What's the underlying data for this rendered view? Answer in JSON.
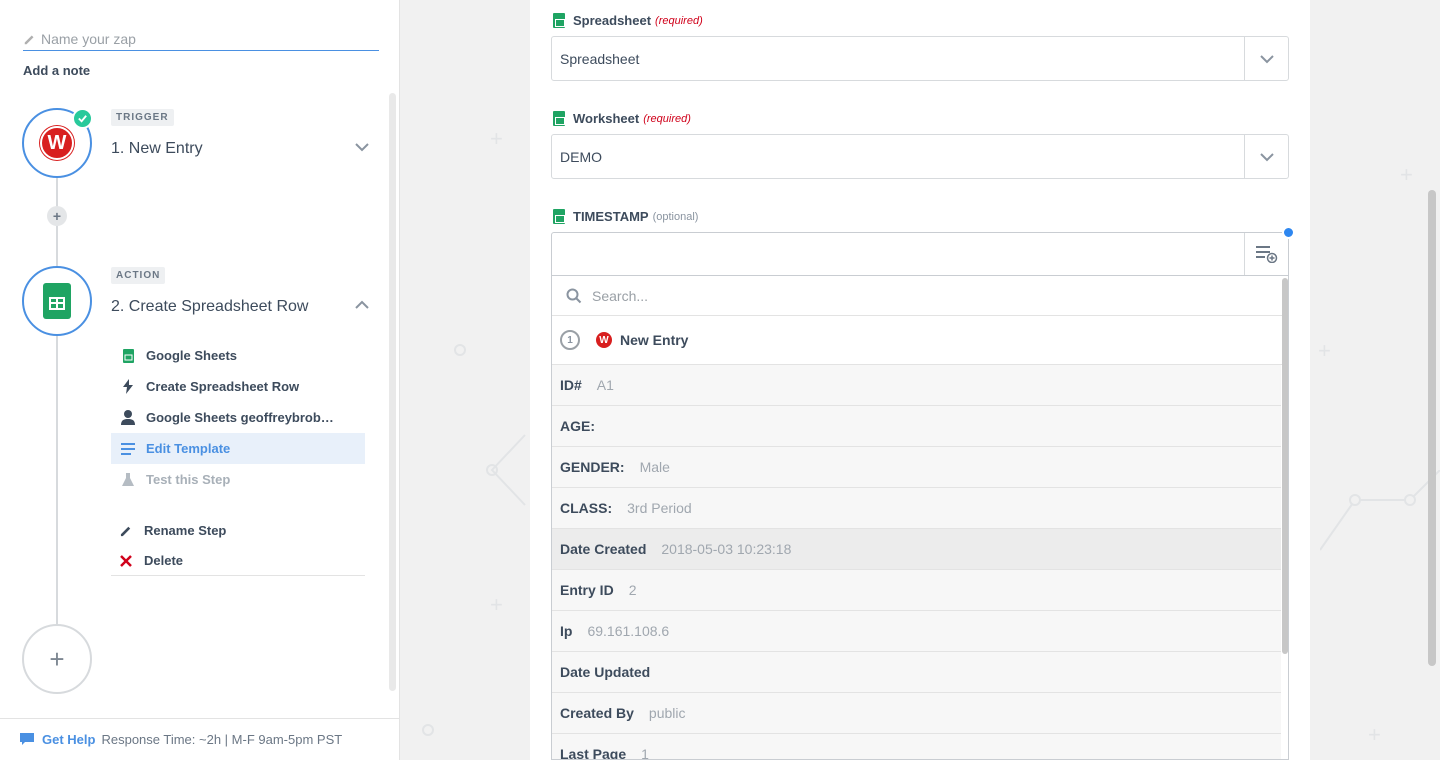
{
  "sidebar": {
    "zap_name_placeholder": "Name your zap",
    "add_note": "Add a note",
    "trigger": {
      "badge": "TRIGGER",
      "title": "1. New Entry",
      "app_icon_letter": "W"
    },
    "action": {
      "badge": "ACTION",
      "title": "2. Create Spreadsheet Row",
      "menu": [
        {
          "label": "Google Sheets",
          "icon": "sheets-icon"
        },
        {
          "label": "Create Spreadsheet Row",
          "icon": "bolt-icon"
        },
        {
          "label": "Google Sheets geoffreybrob…",
          "icon": "user-icon"
        },
        {
          "label": "Edit Template",
          "icon": "list-icon",
          "active": true
        },
        {
          "label": "Test this Step",
          "icon": "flask-icon",
          "muted": true
        }
      ],
      "rename": "Rename Step",
      "delete": "Delete"
    },
    "footer": {
      "get_help": "Get Help",
      "response_time": "Response Time: ~2h | M-F 9am-5pm PST"
    }
  },
  "main": {
    "spreadsheet": {
      "label": "Spreadsheet",
      "tag": "(required)",
      "value": "Spreadsheet"
    },
    "worksheet": {
      "label": "Worksheet",
      "tag": "(required)",
      "value": "DEMO"
    },
    "timestamp": {
      "label": "TIMESTAMP",
      "tag": "(optional)",
      "value": ""
    },
    "dropdown": {
      "search_placeholder": "Search...",
      "group": {
        "number": "1",
        "icon_letter": "W",
        "label": "New Entry"
      },
      "fields": [
        {
          "key": "ID#",
          "value": "A1"
        },
        {
          "key": "AGE:",
          "value": ""
        },
        {
          "key": "GENDER:",
          "value": "Male"
        },
        {
          "key": "CLASS:",
          "value": "3rd Period"
        },
        {
          "key": "Date Created",
          "value": "2018-05-03 10:23:18"
        },
        {
          "key": "Entry ID",
          "value": "2"
        },
        {
          "key": "Ip",
          "value": "69.161.108.6"
        },
        {
          "key": "Date Updated",
          "value": ""
        },
        {
          "key": "Created By",
          "value": "public"
        },
        {
          "key": "Last Page",
          "value": "1"
        }
      ]
    }
  },
  "colors": {
    "accent": "#4a90e2",
    "sheets_green": "#1fa463",
    "wufoo_red": "#d81f1f",
    "success": "#28c99b",
    "required": "#d0021b"
  }
}
